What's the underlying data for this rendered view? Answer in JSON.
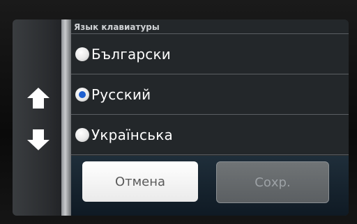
{
  "header": {
    "title": "Язык клавиатуры"
  },
  "languages": [
    {
      "label": "Български",
      "checked": false
    },
    {
      "label": "Русский",
      "checked": true
    },
    {
      "label": "Українська",
      "checked": false
    }
  ],
  "buttons": {
    "cancel": "Отмена",
    "save": "Сохр."
  },
  "icons": {
    "scroll_up": "arrow-up-icon",
    "scroll_down": "arrow-down-icon"
  },
  "colors": {
    "radio_selected": "#1d5fd0",
    "background": "#23272a"
  }
}
